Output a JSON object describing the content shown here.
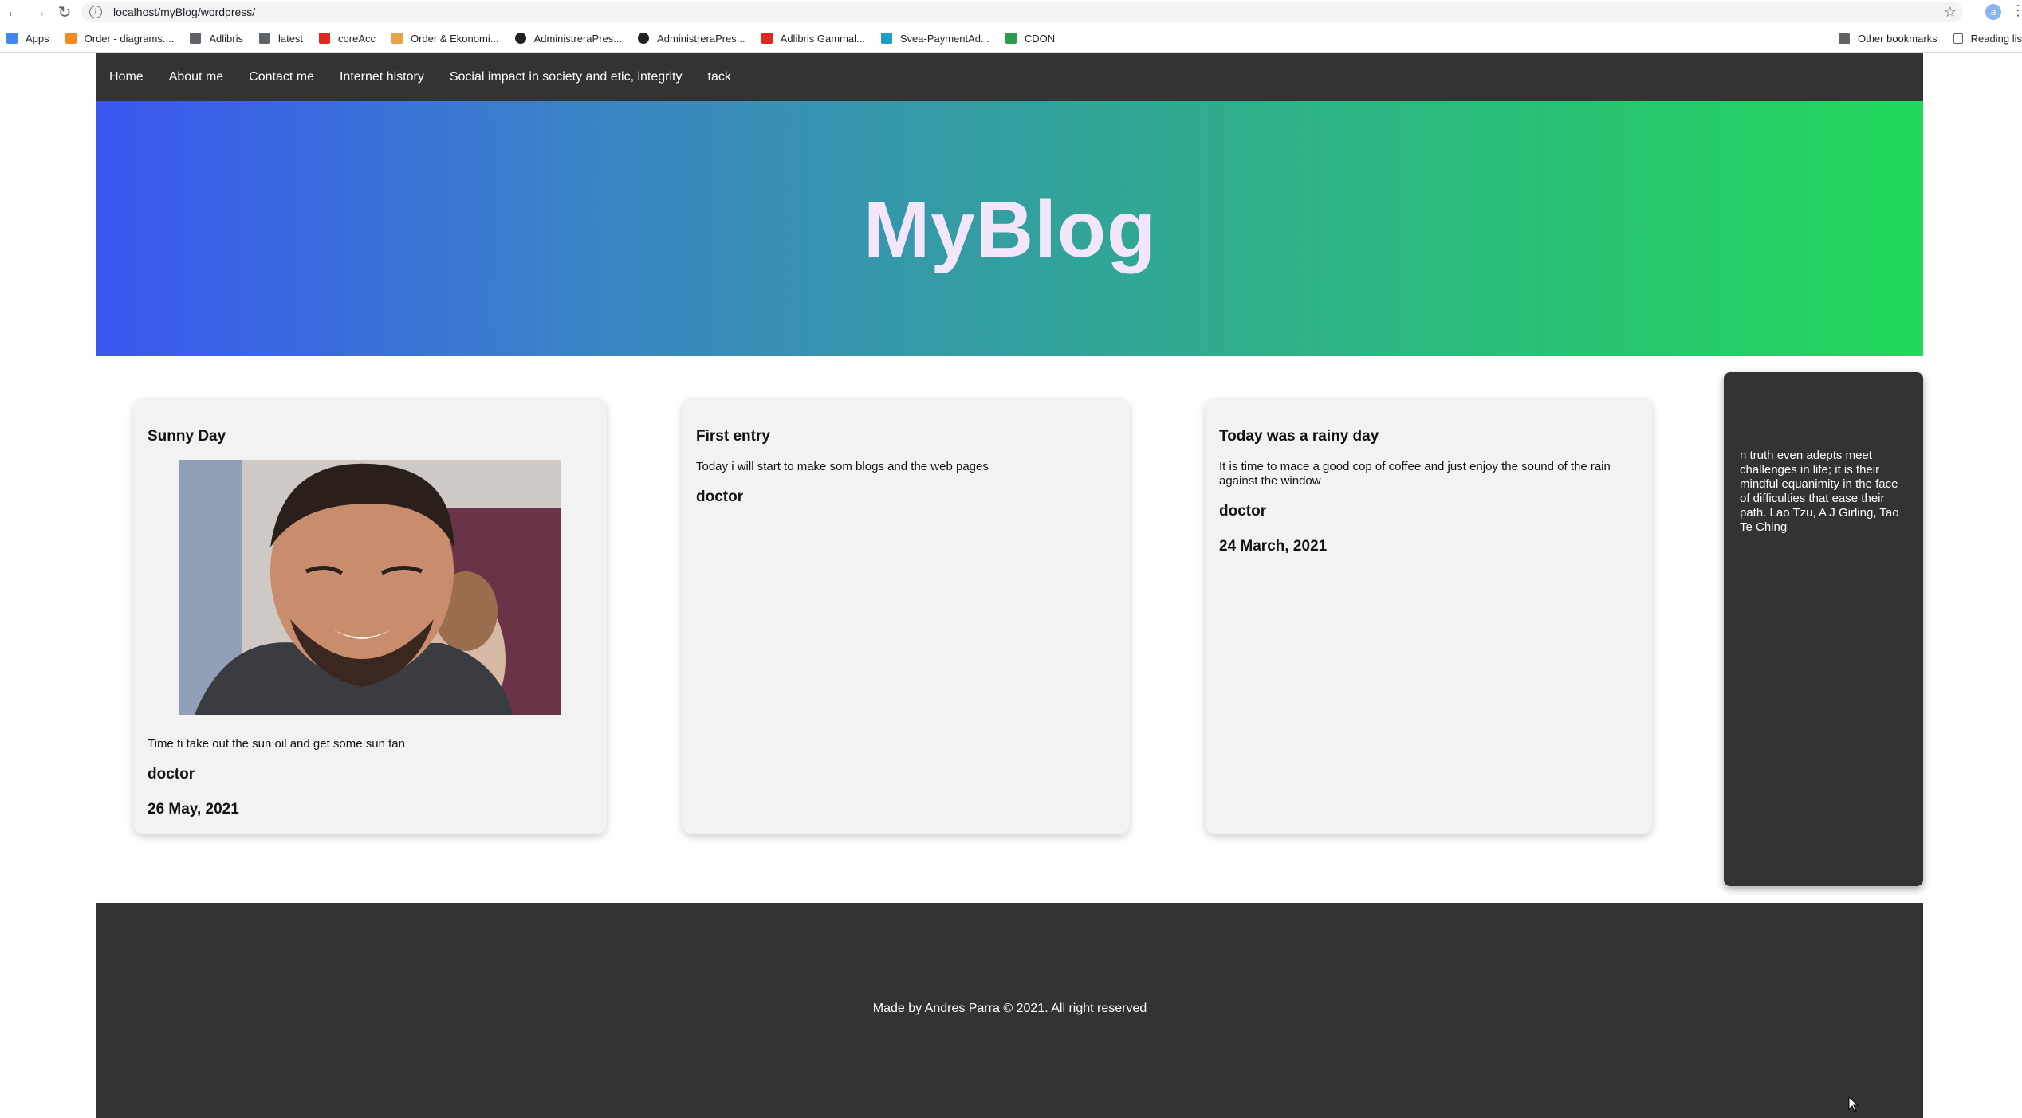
{
  "browser": {
    "url": "localhost/myBlog/wordpress/",
    "avatar_letter": "a",
    "bookmarks": [
      {
        "label": "Apps",
        "icon": "apps-grid-icon",
        "color": "#4285f4"
      },
      {
        "label": "Order - diagrams....",
        "icon": "orange-logo-icon",
        "color": "#f28b1d"
      },
      {
        "label": "Adlibris",
        "icon": "folder-icon",
        "color": "#5f6368"
      },
      {
        "label": "latest",
        "icon": "folder-icon",
        "color": "#5f6368"
      },
      {
        "label": "coreAcc",
        "icon": "acrobat-icon",
        "color": "#e3261d"
      },
      {
        "label": "Order & Ekonomi...",
        "icon": "pencil-logo-icon",
        "color": "#e8a24a"
      },
      {
        "label": "AdministreraPres...",
        "icon": "globe-icon",
        "color": "#202124"
      },
      {
        "label": "AdministreraPres...",
        "icon": "globe-icon",
        "color": "#202124"
      },
      {
        "label": "Adlibris Gammal...",
        "icon": "acrobat-icon",
        "color": "#e3261d"
      },
      {
        "label": "Svea-PaymentAd...",
        "icon": "svea-logo-icon",
        "color": "#1aa0c8"
      },
      {
        "label": "CDON",
        "icon": "cdon-logo-icon",
        "color": "#2a9d4a"
      }
    ],
    "other_bookmarks": "Other bookmarks",
    "reading_list": "Reading lis"
  },
  "site": {
    "nav": [
      "Home",
      "About me",
      "Contact me",
      "Internet history",
      "Social impact in society and etic, integrity",
      "tack"
    ],
    "title": "MyBlog",
    "posts": [
      {
        "title": "Sunny Day",
        "has_image": true,
        "body": "Time ti take out the sun oil and get some sun tan",
        "author": "doctor",
        "date": "26 May, 2021"
      },
      {
        "title": "First entry",
        "has_image": false,
        "body": "Today i will start to make som blogs and the web pages",
        "author": "doctor",
        "date": ""
      },
      {
        "title": "Today was a rainy day",
        "has_image": false,
        "body": "It is time to mace a good cop of coffee and just enjoy the sound of the rain against the window",
        "author": "doctor",
        "date": "24 March, 2021"
      }
    ],
    "sidebar_quote": "n truth even adepts meet challenges in life; it is their mindful equanimity in the face of difficulties that ease their path. Lao Tzu, A J Girling, Tao Te Ching",
    "footer": "Made by Andres Parra © 2021. All right reserved"
  },
  "colors": {
    "nav_bg": "#333333",
    "hero_start": "#3a57f0",
    "hero_end": "#22d85a",
    "title_color": "#f3e6fb",
    "card_bg": "#f2f2f2"
  }
}
